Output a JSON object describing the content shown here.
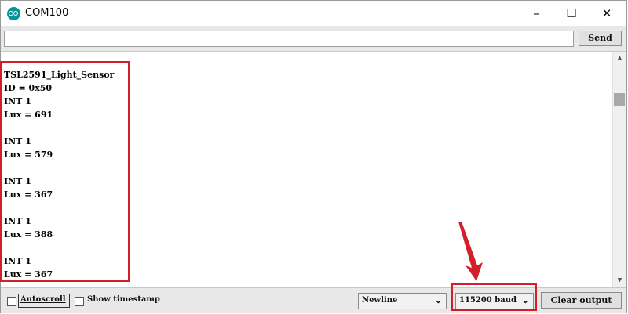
{
  "window": {
    "title": "COM100",
    "minimize": "–",
    "maximize": "☐",
    "close": "✕"
  },
  "send_row": {
    "input_value": "",
    "send_label": "Send"
  },
  "output": {
    "lines": [
      "TSL2591_Light_Sensor",
      "ID = 0x50",
      "INT 1",
      "Lux = 691",
      "",
      "INT 1",
      "Lux = 579",
      "",
      "INT 1",
      "Lux = 367",
      "",
      "INT 1",
      "Lux = 388",
      "",
      "INT 1",
      "Lux = 367"
    ]
  },
  "bottom_bar": {
    "autoscroll_label": "Autoscroll",
    "autoscroll_checked": false,
    "timestamp_label": "Show timestamp",
    "timestamp_checked": false,
    "line_ending": "Newline",
    "baud_rate": "115200 baud",
    "clear_label": "Clear output"
  },
  "colors": {
    "highlight": "#d21f2a",
    "arduino_teal": "#00979c"
  }
}
